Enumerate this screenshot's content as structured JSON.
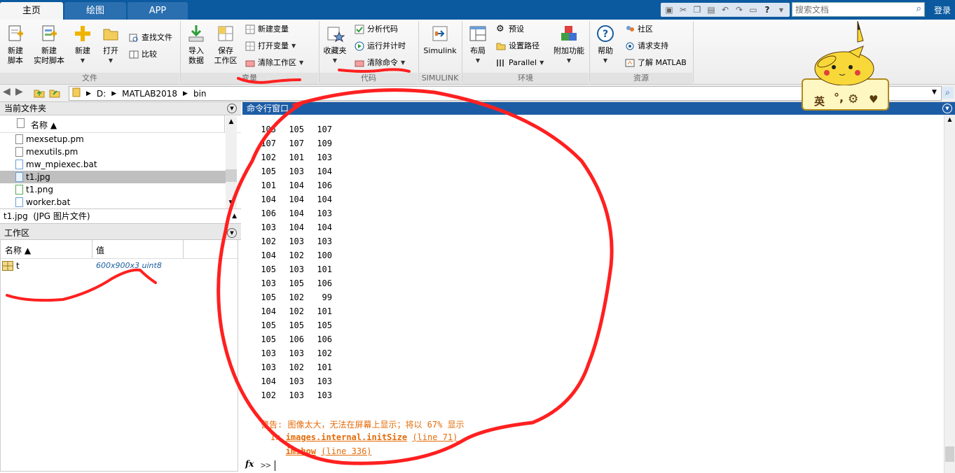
{
  "tabs": [
    {
      "label": "主页",
      "active": true
    },
    {
      "label": "绘图",
      "active": false
    },
    {
      "label": "APP",
      "active": false
    }
  ],
  "search": {
    "placeholder": "搜索文档"
  },
  "login": "登录",
  "ribbon": {
    "groups": {
      "file": "文件",
      "variable": "变量",
      "code": "代码",
      "simulink": "SIMULINK",
      "env": "环境",
      "resource": "资源"
    },
    "new_script": [
      "新建",
      "脚本"
    ],
    "new_live_script": [
      "新建",
      "实时脚本"
    ],
    "new": "新建",
    "open": "打开",
    "find_files": "查找文件",
    "compare": "比较",
    "import_data": [
      "导入",
      "数据"
    ],
    "save_workspace": [
      "保存",
      "工作区"
    ],
    "new_variable": "新建变量",
    "open_variable": "打开变量",
    "clear_workspace": "清除工作区",
    "favorites": "收藏夹",
    "analyze_code": "分析代码",
    "run_time": "运行并计时",
    "clear_commands": "清除命令",
    "simulink": "Simulink",
    "layout": "布局",
    "preferences": "预设",
    "set_path": "设置路径",
    "parallel": "Parallel",
    "add_ons": "附加功能",
    "help": "帮助",
    "community": "社区",
    "request_support": "请求支持",
    "learn_matlab": "了解 MATLAB"
  },
  "path": [
    "D:",
    "MATLAB2018",
    "bin"
  ],
  "current_folder": {
    "title": "当前文件夹",
    "name_header": "名称 ▲",
    "files": [
      {
        "name": "mexsetup.pm",
        "selected": false
      },
      {
        "name": "mexutils.pm",
        "selected": false
      },
      {
        "name": "mw_mpiexec.bat",
        "selected": false
      },
      {
        "name": "t1.jpg",
        "selected": true
      },
      {
        "name": "t1.png",
        "selected": false
      },
      {
        "name": "worker.bat",
        "selected": false
      }
    ],
    "detail": "t1.jpg  (JPG 图片文件)"
  },
  "workspace": {
    "title": "工作区",
    "col_name": "名称 ▲",
    "col_value": "值",
    "vars": [
      {
        "name": "t",
        "value": "600x900x3 uint8"
      }
    ]
  },
  "command_window": {
    "title": "命令行窗口",
    "rows": [
      [
        "105",
        "105",
        "107"
      ],
      [
        "107",
        "107",
        "109"
      ],
      [
        "102",
        "101",
        "103"
      ],
      [
        "105",
        "103",
        "104"
      ],
      [
        "101",
        "104",
        "106"
      ],
      [
        "104",
        "104",
        "104"
      ],
      [
        "106",
        "104",
        "103"
      ],
      [
        "103",
        "104",
        "104"
      ],
      [
        "102",
        "103",
        "103"
      ],
      [
        "104",
        "102",
        "100"
      ],
      [
        "105",
        "103",
        "101"
      ],
      [
        "103",
        "105",
        "106"
      ],
      [
        "105",
        "102",
        "99"
      ],
      [
        "104",
        "102",
        "101"
      ],
      [
        "105",
        "105",
        "105"
      ],
      [
        "105",
        "106",
        "106"
      ],
      [
        "103",
        "103",
        "102"
      ],
      [
        "103",
        "102",
        "101"
      ],
      [
        "104",
        "103",
        "103"
      ],
      [
        "102",
        "103",
        "103"
      ]
    ],
    "warning": "警告: 图像太大，无法在屏幕上显示；将以 67% 显示",
    "trace1_in": "In ",
    "trace1_fn": "images.internal.initSize",
    "trace1_line": "(line 71)",
    "trace2_fn": "imshow",
    "trace2_line": "(line 336)",
    "prompt": ">>",
    "fx": "fx"
  },
  "badge": {
    "text": "英"
  },
  "colors": {
    "accent": "#1c5ca5",
    "annotation": "#ff2020",
    "warning": "#e46c0a"
  }
}
